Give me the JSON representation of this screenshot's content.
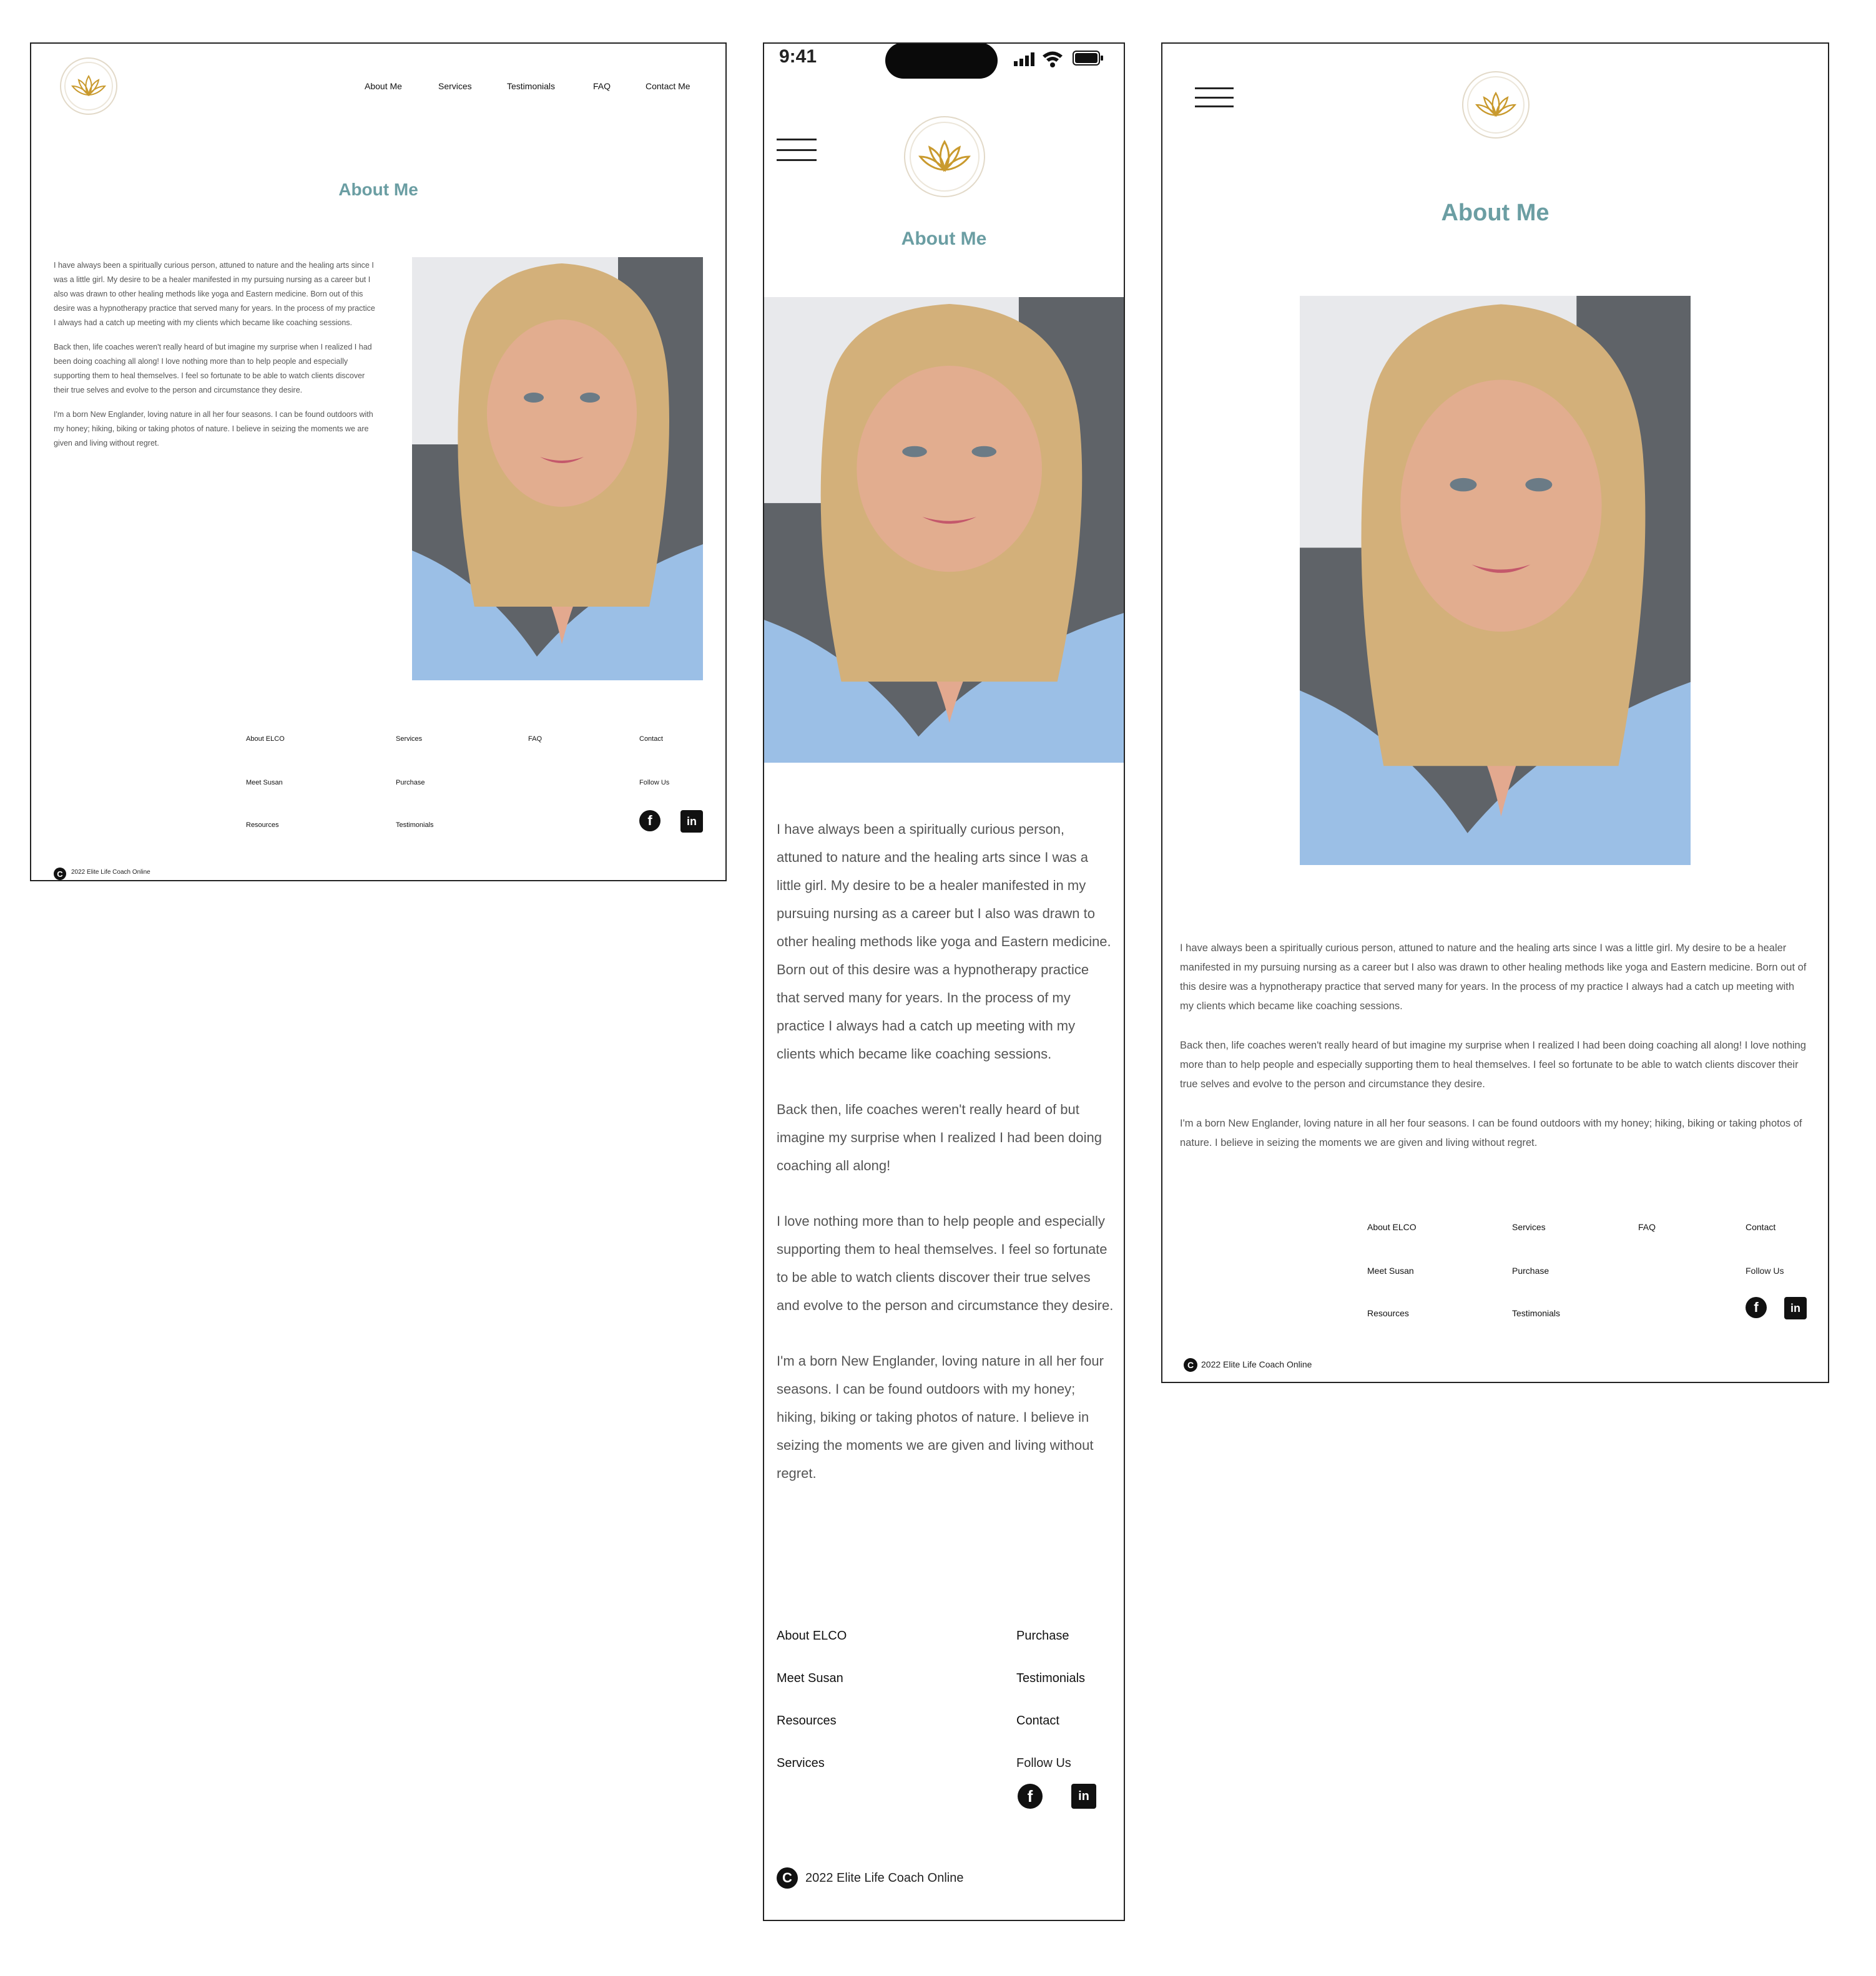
{
  "brand": {
    "logo_text": "Elite Life Coach Online",
    "copyright": "2022 Elite Life Coach Online",
    "copyright_icon": "C"
  },
  "nav": {
    "items": [
      "About Me",
      "Services",
      "Testimonials",
      "FAQ",
      "Contact Me"
    ]
  },
  "page": {
    "title": "About Me",
    "paragraphs": [
      "I have always been a spiritually curious person, attuned to nature and the healing arts since I was a little girl. My desire to be a healer manifested in my pursuing nursing as a career but I also was drawn to other healing methods like yoga and Eastern medicine. Born out of this desire was a hypnotherapy practice that served many for years. In the process of my practice I always had a catch up meeting with my clients which became like coaching sessions.",
      "Back then, life coaches weren't really heard of but imagine my surprise when I realized I had been doing coaching all along! I love nothing more than to help people and especially supporting them to heal themselves. I feel so fortunate to be able to watch clients discover their true selves and evolve to the person and circumstance they desire.",
      "I'm a born New Englander, loving nature in all her four seasons. I can be found outdoors with my honey; hiking, biking or taking photos of nature. I believe in seizing the moments we are given and living without regret."
    ],
    "mobile_paragraphs": [
      "I have always been a spiritually curious person, attuned to nature and the healing arts since I was a little girl. My desire to be a healer manifested in my pursuing nursing as a career but I also was drawn to other healing methods like yoga and Eastern medicine. Born out of this desire was a hypnotherapy practice that served many for years. In the process of my practice I always had a catch up meeting with my clients which became like coaching sessions.",
      "Back then, life coaches weren't really heard of but imagine my surprise when I realized I had been doing coaching all along!",
      "I love nothing more than to help people and especially supporting them to heal themselves. I feel so fortunate to be able to watch clients discover their true selves and evolve to the person and circumstance they desire.",
      "I'm a born New Englander, loving nature in all her four seasons. I can be found outdoors with my honey; hiking, biking or taking photos of nature. I believe in seizing the moments we are given and living without regret."
    ]
  },
  "footer": {
    "about": "About ELCO",
    "meet": "Meet Susan",
    "resources": "Resources",
    "services": "Services",
    "purchase": "Purchase",
    "testimonials": "Testimonials",
    "faq": "FAQ",
    "contact": "Contact",
    "follow": "Follow Us",
    "facebook_glyph": "f",
    "linkedin_glyph": "in"
  },
  "status_bar": {
    "time": "9:41"
  },
  "colors": {
    "title": "#6b9ea3",
    "logo_gold": "#c99a2e",
    "border": "#222222"
  }
}
